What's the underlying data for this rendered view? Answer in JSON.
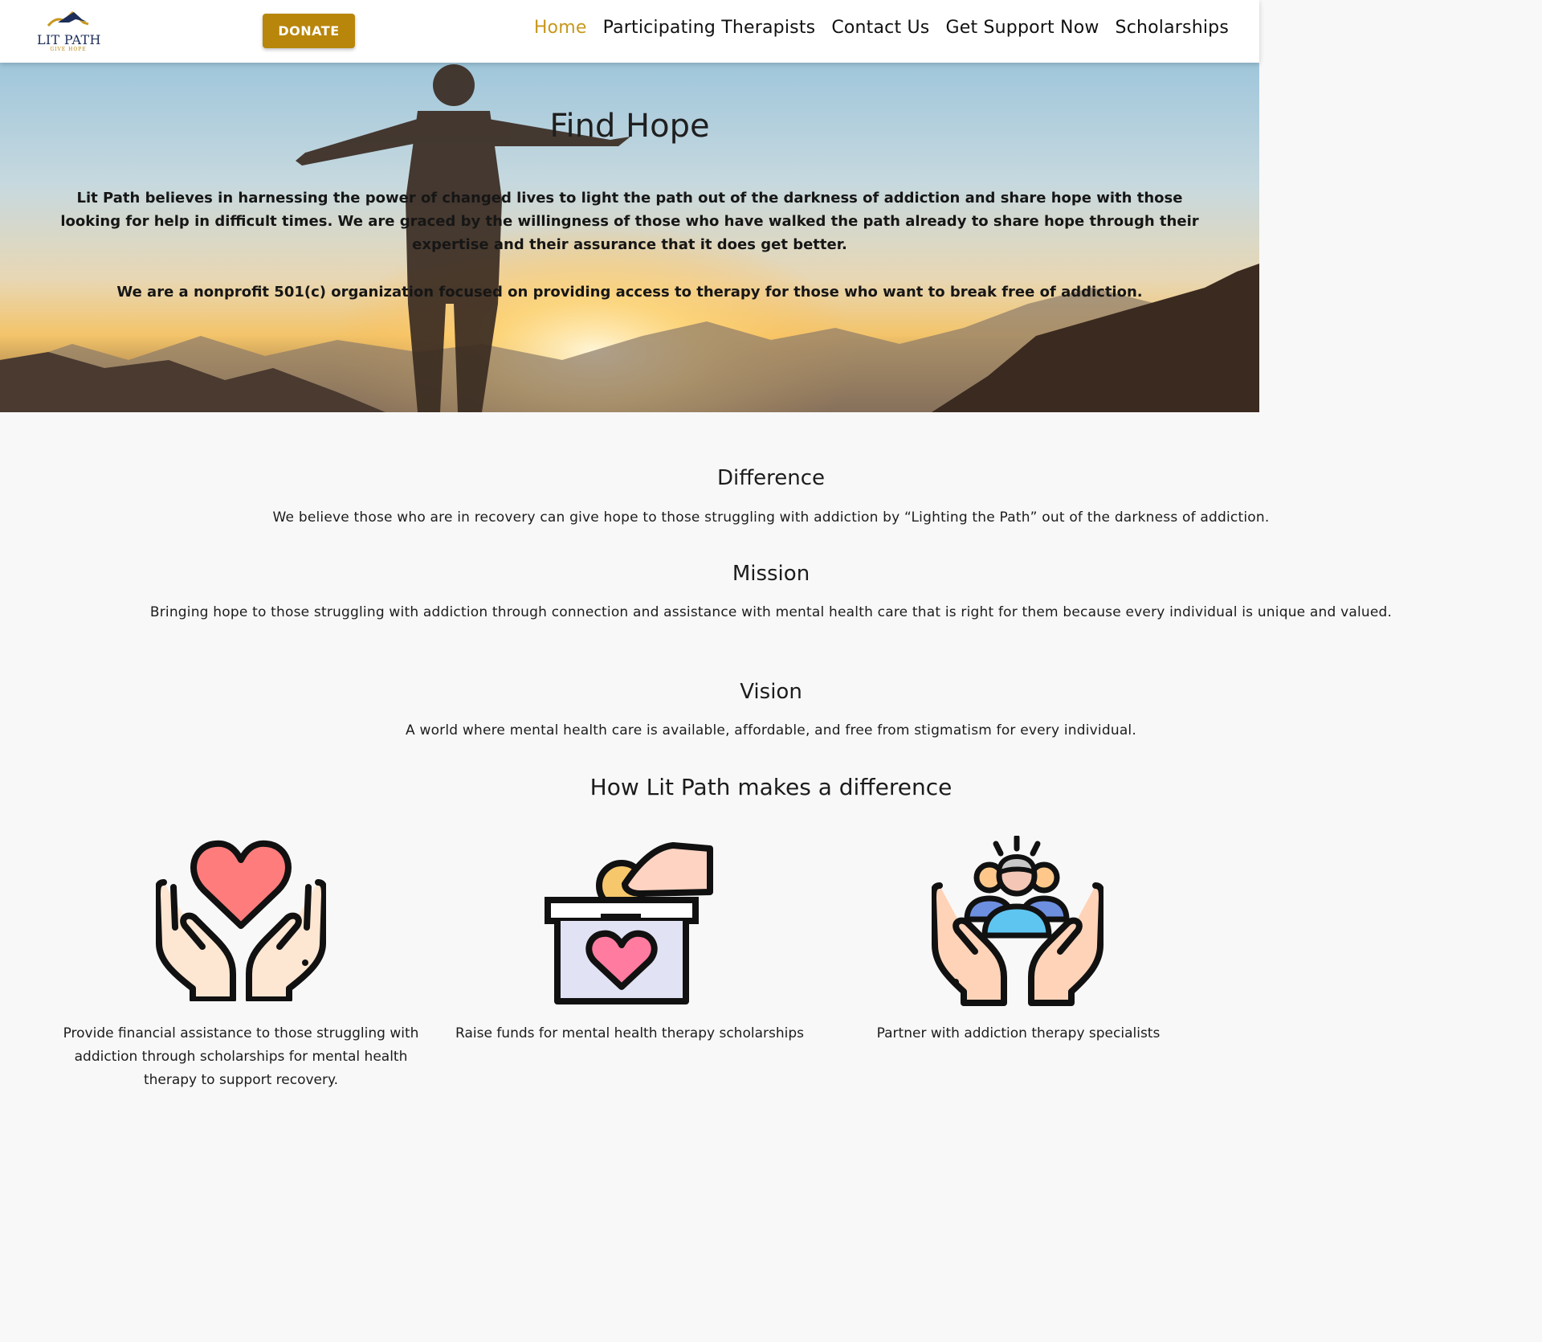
{
  "header": {
    "logo": {
      "name": "LIT PATH",
      "tagline": "GIVE HOPE"
    },
    "donate_label": "DONATE",
    "nav": [
      {
        "label": "Home",
        "active": true
      },
      {
        "label": "Participating Therapists",
        "active": false
      },
      {
        "label": "Contact Us",
        "active": false
      },
      {
        "label": "Get Support Now",
        "active": false
      },
      {
        "label": "Scholarships",
        "active": false
      }
    ]
  },
  "hero": {
    "title": "Find Hope",
    "paragraph1": "Lit Path believes in harnessing the power of changed lives to light the path out of the darkness of addiction and share hope with those looking for help in difficult times. We are graced by the willingness of those who have walked the path already to share hope through their expertise and their assurance that it does get better.",
    "paragraph2": "We are a nonprofit 501(c) organization focused on providing access to therapy for those who want to break free of addiction."
  },
  "sections": {
    "difference": {
      "title": "Difference",
      "text": "We believe those who are in recovery can give hope to those struggling with addiction by “Lighting the Path” out of the darkness of addiction."
    },
    "mission": {
      "title": "Mission",
      "text": "Bringing hope to those struggling with addiction through connection and assistance with mental health care that is right for them because every individual is unique and valued."
    },
    "vision": {
      "title": "Vision",
      "text": "A world where mental health care is available, affordable, and free from stigmatism for every individual."
    },
    "how": {
      "title": "How Lit Path makes a difference"
    }
  },
  "features": [
    {
      "icon": "hands-heart-icon",
      "caption": "Provide financial assistance to those struggling with addiction through scholarships for mental health therapy to support recovery."
    },
    {
      "icon": "donation-box-icon",
      "caption": "Raise funds for mental health therapy scholarships"
    },
    {
      "icon": "hands-people-icon",
      "caption": "Partner with addiction therapy specialists"
    }
  ],
  "colors": {
    "accent": "#b8860b",
    "nav_active": "#c8981e",
    "logo_navy": "#1d2e5a",
    "background": "#f8f8f8"
  }
}
